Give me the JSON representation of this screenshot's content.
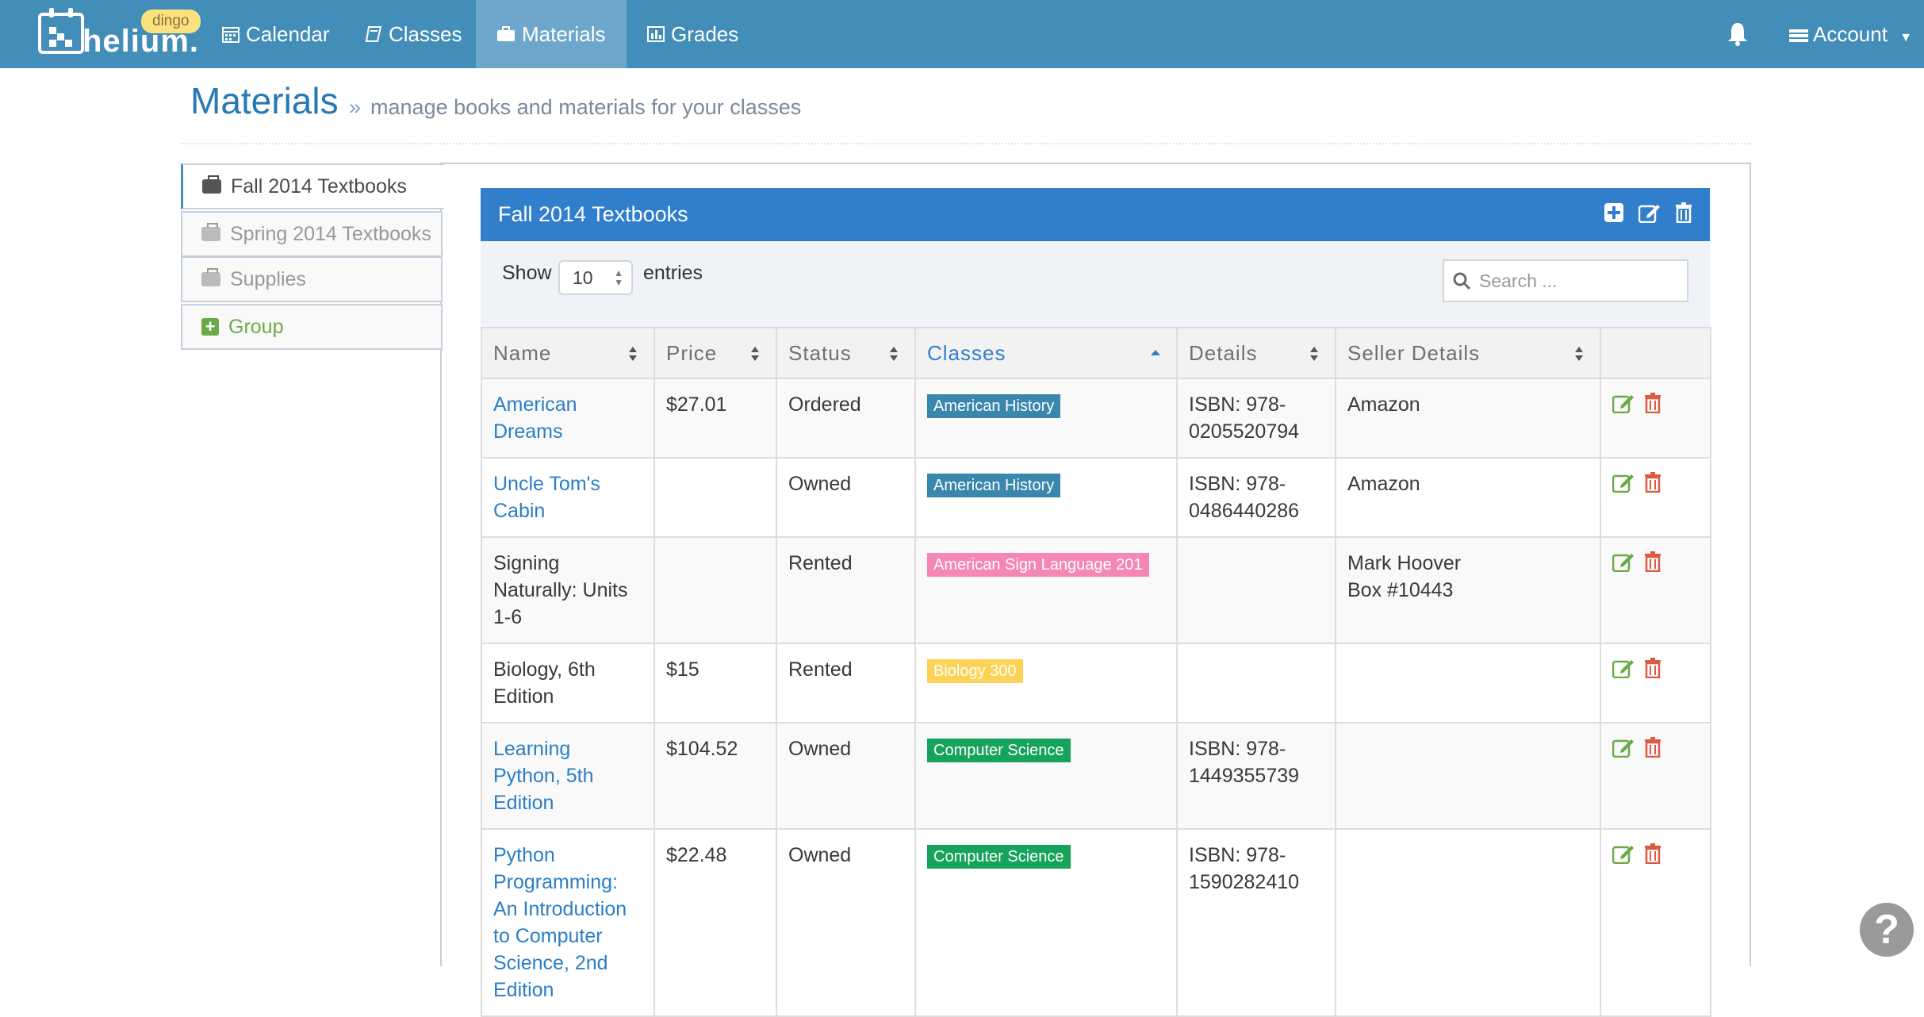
{
  "nav": {
    "brand": "helium.",
    "badge": "dingo",
    "items": [
      {
        "label": "Calendar",
        "icon": "calendar-icon"
      },
      {
        "label": "Classes",
        "icon": "book-icon"
      },
      {
        "label": "Materials",
        "icon": "briefcase-icon",
        "active": true
      },
      {
        "label": "Grades",
        "icon": "bar-chart-icon"
      }
    ],
    "account_label": "Account"
  },
  "page": {
    "title": "Materials",
    "subtitle": "manage books and materials for your classes"
  },
  "groups": [
    {
      "label": "Fall 2014 Textbooks",
      "active": true
    },
    {
      "label": "Spring 2014 Textbooks"
    },
    {
      "label": "Supplies"
    }
  ],
  "add_group_label": "Group",
  "widget": {
    "title": "Fall 2014 Textbooks",
    "show_label": "Show",
    "page_length": "10",
    "entries_label": "entries",
    "search_placeholder": "Search ..."
  },
  "table": {
    "columns": [
      "Name",
      "Price",
      "Status",
      "Classes",
      "Details",
      "Seller Details"
    ],
    "rows": [
      {
        "name": "American Dreams",
        "linked": true,
        "price": "$27.01",
        "status": "Ordered",
        "class": "American History",
        "class_color": "#3a87ad",
        "details": "ISBN: 978-0205520794",
        "seller": "Amazon"
      },
      {
        "name": "Uncle Tom's Cabin",
        "linked": true,
        "price": "",
        "status": "Owned",
        "class": "American History",
        "class_color": "#3a87ad",
        "details": "ISBN: 978-0486440286",
        "seller": "Amazon"
      },
      {
        "name": "Signing Naturally: Units 1-6",
        "linked": false,
        "price": "",
        "status": "Rented",
        "class": "American Sign Language 201",
        "class_color": "#f487b4",
        "details": "",
        "seller": "Mark Hoover\nBox #10443"
      },
      {
        "name": "Biology, 6th Edition",
        "linked": false,
        "price": "$15",
        "status": "Rented",
        "class": "Biology 300",
        "class_color": "#fcd356",
        "details": "",
        "seller": ""
      },
      {
        "name": "Learning Python, 5th Edition",
        "linked": true,
        "price": "$104.52",
        "status": "Owned",
        "class": "Computer Science",
        "class_color": "#16a35b",
        "details": "ISBN: 978-1449355739",
        "seller": ""
      },
      {
        "name": "Python Programming: An Introduction to Computer Science, 2nd Edition",
        "linked": true,
        "price": "$22.48",
        "status": "Owned",
        "class": "Computer Science",
        "class_color": "#16a35b",
        "details": "ISBN: 978-1590282410",
        "seller": ""
      }
    ]
  },
  "colors": {
    "navbar": "#438eb9",
    "widget_header": "#307ecc",
    "edit_icon": "#69aa46",
    "delete_icon": "#dd5a43"
  },
  "help_icon": "?"
}
